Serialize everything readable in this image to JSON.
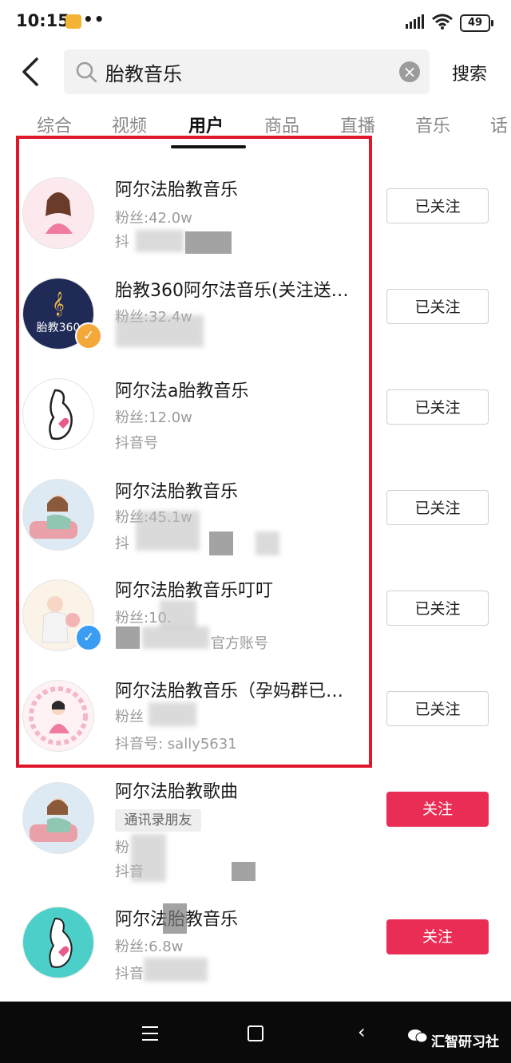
{
  "status_bar": {
    "time": "10:15",
    "dots": "••",
    "battery": "49"
  },
  "header": {
    "query": "胎教音乐",
    "clear_symbol": "×",
    "search_label": "搜索"
  },
  "tabs": [
    {
      "label": "综合"
    },
    {
      "label": "视频"
    },
    {
      "label": "用户"
    },
    {
      "label": "商品"
    },
    {
      "label": "直播"
    },
    {
      "label": "音乐"
    },
    {
      "label": "话"
    }
  ],
  "users": [
    {
      "name": "阿尔法胎教音乐",
      "fans": "粉丝:42.0w",
      "id": "抖",
      "button": "已关注"
    },
    {
      "name": "胎教360阿尔法音乐(关注送…",
      "fans": "粉丝:32.4w",
      "id": "",
      "button": "已关注",
      "avatar_text": "胎教360"
    },
    {
      "name": "阿尔法a胎教音乐",
      "fans": "粉丝:12.0w",
      "id": "抖音号",
      "button": "已关注"
    },
    {
      "name": "阿尔法胎教音乐",
      "fans": "粉丝:45.1w",
      "id": "抖",
      "button": "已关注"
    },
    {
      "name": "阿尔法胎教音乐叮叮",
      "fans": "粉丝:10.",
      "id": "官方账号",
      "button": "已关注"
    },
    {
      "name": "阿尔法胎教音乐（孕妈群已…",
      "fans": "粉丝",
      "id": "抖音号: sally5631",
      "button": "已关注"
    },
    {
      "name": "阿尔法胎教歌曲",
      "tag": "通讯录朋友",
      "fans": "粉",
      "id": "抖音",
      "button": "关注"
    },
    {
      "name": "阿尔法胎教音乐",
      "fans": "粉丝:6.8w",
      "id": "抖音",
      "button": "关注"
    }
  ],
  "nav": {
    "watermark": "汇智研习社"
  },
  "colors": {
    "frame": "#e0162b",
    "follow": "#ea2d54",
    "verify_gold": "#f3a93a",
    "verify_blue": "#3a9cf3"
  }
}
